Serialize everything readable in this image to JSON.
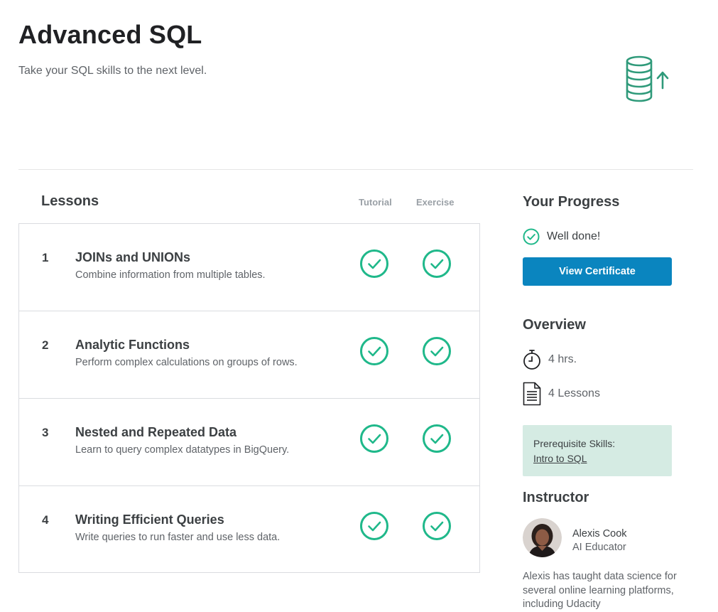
{
  "course": {
    "title": "Advanced SQL",
    "subtitle": "Take your SQL skills to the next level.",
    "hero_icon": "database-stack-up-arrow-icon"
  },
  "lessons_section": {
    "heading": "Lessons",
    "columns": [
      "Tutorial",
      "Exercise"
    ],
    "items": [
      {
        "number": "1",
        "title": "JOINs and UNIONs",
        "description": "Combine information from multiple tables.",
        "tutorial_done": true,
        "exercise_done": true
      },
      {
        "number": "2",
        "title": "Analytic Functions",
        "description": "Perform complex calculations on groups of rows.",
        "tutorial_done": true,
        "exercise_done": true
      },
      {
        "number": "3",
        "title": "Nested and Repeated Data",
        "description": "Learn to query complex datatypes in BigQuery.",
        "tutorial_done": true,
        "exercise_done": true
      },
      {
        "number": "4",
        "title": "Writing Efficient Queries",
        "description": "Write queries to run faster and use less data.",
        "tutorial_done": true,
        "exercise_done": true
      }
    ]
  },
  "progress": {
    "heading": "Your Progress",
    "status": "Well done!",
    "status_icon": "check-circle-icon",
    "button_label": "View Certificate"
  },
  "overview": {
    "heading": "Overview",
    "duration": "4 hrs.",
    "duration_icon": "stopwatch-icon",
    "lesson_count": "4 Lessons",
    "lesson_count_icon": "document-icon"
  },
  "prerequisites": {
    "label": "Prerequisite Skills:",
    "link": "Intro to SQL"
  },
  "instructor": {
    "heading": "Instructor",
    "name": "Alexis Cook",
    "role": "AI Educator",
    "bio": "Alexis has taught data science for several online learning platforms, including Udacity"
  },
  "colors": {
    "accent_green": "#1fb88a",
    "button_blue": "#0a85bf",
    "prereq_bg": "#d5ebe3",
    "hero_green": "#2f9a7a"
  }
}
